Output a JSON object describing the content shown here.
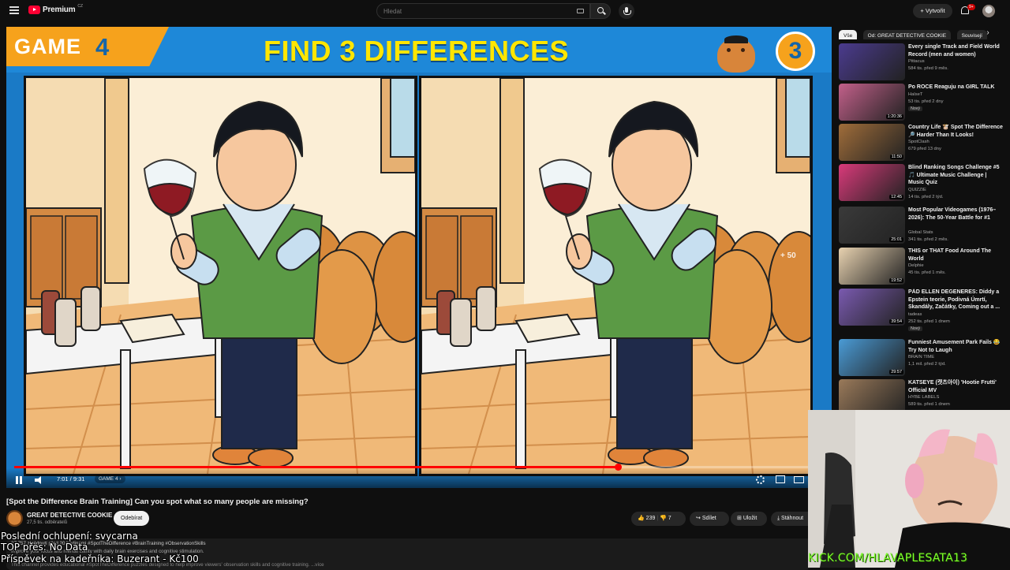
{
  "topbar": {
    "logo_text": "Premium",
    "logo_region": "CZ",
    "search_placeholder": "Hledat",
    "create_label": "+ Vytvořit",
    "notif_count": "9+"
  },
  "video_frame": {
    "game_label": "GAME",
    "game_number": "4",
    "headline": "FIND 3 DIFFERENCES",
    "countdown": "3",
    "skip_badge": "+ 50"
  },
  "player": {
    "progress": 0.75,
    "time": "7:01 / 9:31",
    "chapter": "GAME 4 ›"
  },
  "video": {
    "title": "[Spot the Difference Brain Training] Can you spot what so many people are missing?",
    "channel": "GREAT DETECTIVE COOKIE",
    "subscribers": "27,5 tis. odběratelů",
    "subscribe_label": "Odebírat",
    "likes": "239",
    "dislikes": "7",
    "share_label": "Sdílet",
    "save_label": "Uložit",
    "download_label": "Stáhnout",
    "description_meta": "37 757 zhlédnutí  před 20 hodinami  #SpotTheDifference #BrainTraining #ObservationSkills",
    "description_line1": "Improve your focus and mental clarity with daily brain exercises and cognitive stimulation.",
    "description_line2": "This channel provides educational #SpotTheDifference puzzles designed to help improve viewers' observation skills and cognitive training. ...více"
  },
  "overlays": {
    "line1": "Poslední ochlupení: svycarna",
    "line2": "TOP přes: No Data",
    "line3": "Příspěvek na kadeřníka: Buzerant - Kč100"
  },
  "chips": [
    "Vše",
    "Od: GREAT DETECTIVE COOKIE",
    "Souvisejí"
  ],
  "recommendations": [
    {
      "title": "Every single Track and Field World Record (men and women)",
      "channel": "Pittacus",
      "stats": "584 tis.  před 9 měs.",
      "duration": "",
      "badge": "",
      "thumb_color": "#4b3b8f"
    },
    {
      "title": "Po ROCE Reaguju na GIRL TALK",
      "channel": "HalseT",
      "stats": "53 tis.  před 2 dny",
      "duration": "1:20:36",
      "badge": "Nový",
      "thumb_color": "#c2608a"
    },
    {
      "title": "Country Life 🐮 Spot The Difference 🔎 Harder Than It Looks!",
      "channel": "SpotClash",
      "stats": "679  před 13 dny",
      "duration": "11:50",
      "badge": "",
      "thumb_color": "#a06d3a"
    },
    {
      "title": "Blind Ranking Songs Challenge #5 🎵 Ultimate Music Challenge | Music Quiz",
      "channel": "QUIZZIE",
      "stats": "14 tis.  před 2 týd.",
      "duration": "12:45",
      "badge": "",
      "thumb_color": "#d93a7a"
    },
    {
      "title": "Most Popular Videogames (1976–2026): The 50-Year Battle for #1",
      "channel": "Global Stats",
      "stats": "341 tis.  před 2 měs.",
      "duration": "25:01",
      "badge": "",
      "thumb_color": "#3a3a3a"
    },
    {
      "title": "THIS or THAT Food Around The World",
      "channel": "Delphie",
      "stats": "45 tis.  před 1 měs.",
      "duration": "19:52",
      "badge": "",
      "thumb_color": "#e8d2b0"
    },
    {
      "title": "PÁD ELLEN DEGENERES: Diddy a Epstein teorie, Podivná Úmrtí, Skandály, Začátky, Coming out a ...",
      "channel": "tadeas",
      "stats": "252 tis.  před 1 dnem",
      "duration": "39:54",
      "badge": "Nový",
      "thumb_color": "#7a5ab0"
    },
    {
      "title": "Funniest Amusement Park Fails 😂 Try Not to Laugh",
      "channel": "BRAIN TIME",
      "stats": "1,1 mil.  před 2 týd.",
      "duration": "29:57",
      "badge": "",
      "thumb_color": "#4a9bd6"
    },
    {
      "title": "KATSEYE (캣츠아이) 'Hootie Frutti' Official MV",
      "channel": "HYBE LABELS",
      "stats": "589 tis.  před 1 dnem",
      "duration": "",
      "badge": "",
      "thumb_color": "#9a7a5a"
    }
  ],
  "webcam": {
    "caption": "KICK.COM/HLAVAPLESATA13"
  },
  "colors": {
    "accent": "#ff0000",
    "banner_blue": "#1e88d8",
    "headline_yellow": "#ffe600",
    "badge_orange": "#f6a21c",
    "caption_green": "#7dff2b"
  }
}
